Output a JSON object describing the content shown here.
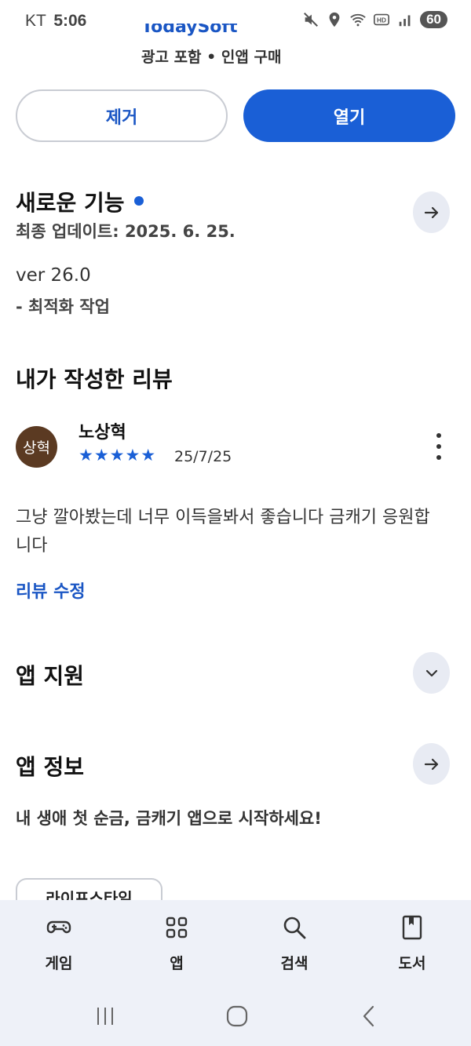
{
  "status_bar": {
    "carrier": "KT",
    "time": "5:06",
    "battery": "60",
    "icons": [
      "mute-icon",
      "location-icon",
      "wifi-icon",
      "hd-icon",
      "signal-icon"
    ]
  },
  "app_header": {
    "developer": "TodaySoft",
    "ad_info": "광고 포함 • 인앱 구매"
  },
  "actions": {
    "remove_label": "제거",
    "open_label": "열기"
  },
  "whats_new": {
    "title": "새로운 기능",
    "last_updated": "최종 업데이트: 2025. 6. 25.",
    "version": "ver 26.0",
    "notes": "- 최적화 작업"
  },
  "my_review": {
    "title": "내가 작성한 리뷰",
    "avatar_text": "상혁",
    "reviewer": "노상혁",
    "rating": 5,
    "stars": "★★★★★",
    "date": "25/7/25",
    "body": "그냥 깔아봤는데 너무 이득을봐서 좋습니다 금캐기 응원합니다",
    "edit_label": "리뷰 수정"
  },
  "app_support": {
    "title": "앱 지원"
  },
  "app_info": {
    "title": "앱 정보",
    "description": "내 생애 첫 순금, 금캐기 앱으로 시작하세요!",
    "category_chip": "라이프스타일"
  },
  "bottom_nav": {
    "items": [
      {
        "label": "게임",
        "icon": "gamepad-icon"
      },
      {
        "label": "앱",
        "icon": "apps-grid-icon"
      },
      {
        "label": "검색",
        "icon": "search-icon"
      },
      {
        "label": "도서",
        "icon": "book-icon"
      }
    ]
  },
  "colors": {
    "accent": "#1a5fd6",
    "link": "#1a56c4",
    "nav_bg": "#eef1f8",
    "avatar_bg": "#5b3a22"
  }
}
